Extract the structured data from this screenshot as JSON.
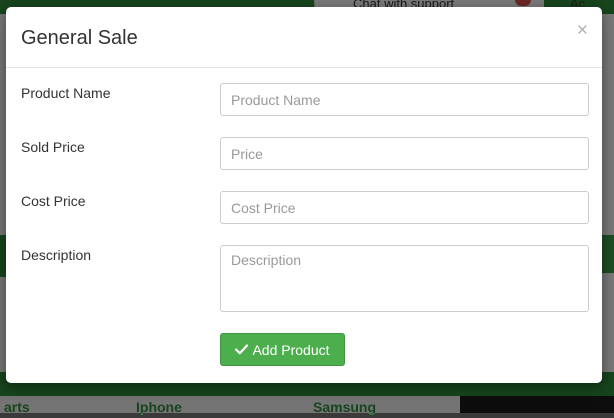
{
  "background": {
    "chat_label": "Chat with support",
    "account_label": "Ac",
    "tabs": [
      "arts",
      "Iphone",
      "Samsung"
    ]
  },
  "modal": {
    "title": "General Sale",
    "close_label": "×",
    "fields": [
      {
        "label": "Product Name",
        "placeholder": "Product Name",
        "value": ""
      },
      {
        "label": "Sold Price",
        "placeholder": "Price",
        "value": ""
      },
      {
        "label": "Cost Price",
        "placeholder": "Cost Price",
        "value": ""
      },
      {
        "label": "Description",
        "placeholder": "Description",
        "value": ""
      }
    ],
    "submit_label": "Add Product",
    "submit_icon": "check-icon"
  },
  "colors": {
    "brand_green": "#2e8b3a",
    "button_green": "#4cae4c"
  }
}
